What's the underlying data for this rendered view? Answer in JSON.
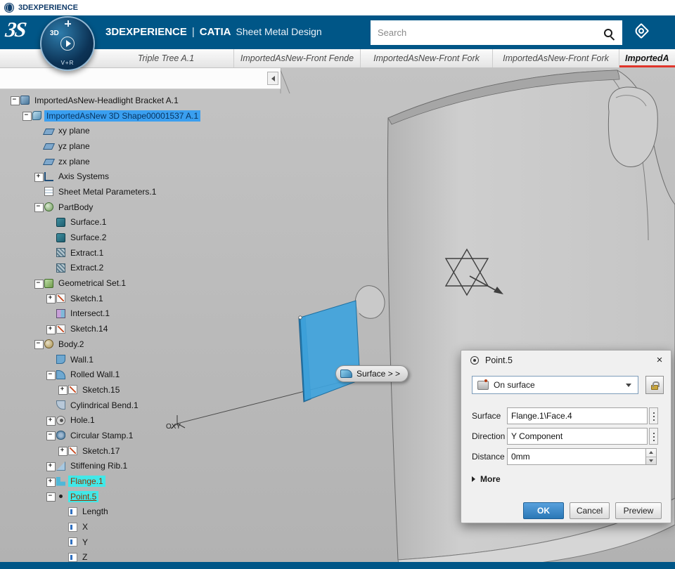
{
  "os_bar": {
    "brand": "3DEXPERIENCE"
  },
  "header": {
    "logo": "3S",
    "product": "3DEXPERIENCE",
    "divider": "|",
    "app": "CATIA",
    "workbench": "Sheet Metal Design",
    "search": {
      "placeholder": "Search"
    },
    "compass": {
      "top": "3D",
      "bottom": "V+R"
    }
  },
  "tabs": [
    {
      "label": "Triple Tree A.1",
      "active": false
    },
    {
      "label": "ImportedAsNew-Front Fende",
      "active": false
    },
    {
      "label": "ImportedAsNew-Front Fork",
      "active": false
    },
    {
      "label": "ImportedAsNew-Front Fork",
      "active": false
    },
    {
      "label": "ImportedA",
      "active": true
    }
  ],
  "tree": [
    {
      "label": "ImportedAsNew-Headlight Bracket A.1",
      "icon": "product",
      "state": "expanded"
    },
    {
      "label": "ImportedAsNew 3D Shape00001537 A.1",
      "icon": "3d-shape",
      "state": "expanded",
      "selected": true
    },
    {
      "label": "xy plane",
      "icon": "plane"
    },
    {
      "label": "yz plane",
      "icon": "plane"
    },
    {
      "label": "zx plane",
      "icon": "plane"
    },
    {
      "label": "Axis Systems",
      "icon": "axis-systems",
      "state": "collapsed"
    },
    {
      "label": "Sheet Metal Parameters.1",
      "icon": "sheet-metal-parameters"
    },
    {
      "label": "PartBody",
      "icon": "part-body",
      "state": "expanded"
    },
    {
      "label": "Surface.1",
      "icon": "surface"
    },
    {
      "label": "Surface.2",
      "icon": "surface"
    },
    {
      "label": "Extract.1",
      "icon": "extract"
    },
    {
      "label": "Extract.2",
      "icon": "extract"
    },
    {
      "label": "Geometrical Set.1",
      "icon": "geometrical-set",
      "state": "expanded"
    },
    {
      "label": "Sketch.1",
      "icon": "sketch",
      "state": "collapsed"
    },
    {
      "label": "Intersect.1",
      "icon": "intersect"
    },
    {
      "label": "Sketch.14",
      "icon": "sketch",
      "state": "collapsed"
    },
    {
      "label": "Body.2",
      "icon": "body",
      "state": "expanded"
    },
    {
      "label": "Wall.1",
      "icon": "wall"
    },
    {
      "label": "Rolled Wall.1",
      "icon": "rolled-wall",
      "state": "expanded"
    },
    {
      "label": "Sketch.15",
      "icon": "sketch",
      "state": "collapsed"
    },
    {
      "label": "Cylindrical Bend.1",
      "icon": "cylindrical-bend"
    },
    {
      "label": "Hole.1",
      "icon": "hole",
      "state": "collapsed"
    },
    {
      "label": "Circular Stamp.1",
      "icon": "circular-stamp",
      "state": "expanded"
    },
    {
      "label": "Sketch.17",
      "icon": "sketch",
      "state": "collapsed"
    },
    {
      "label": "Stiffening Rib.1",
      "icon": "stiffening-rib",
      "state": "collapsed"
    },
    {
      "label": "Flange.1",
      "icon": "flange",
      "state": "collapsed",
      "highlighted": true
    },
    {
      "label": "Point.5",
      "icon": "point",
      "state": "expanded",
      "highlighted": true,
      "in_edit": true
    },
    {
      "label": "Length",
      "icon": "parameter"
    },
    {
      "label": "X",
      "icon": "parameter"
    },
    {
      "label": "Y",
      "icon": "parameter"
    },
    {
      "label": "Z",
      "icon": "parameter"
    }
  ],
  "viewport": {
    "tooltip": "Surface > >",
    "origin_label": "OXY"
  },
  "dialog": {
    "title": "Point.5",
    "close_icon": "×",
    "point_type": "On surface",
    "fields": [
      {
        "label": "Surface",
        "value": "Flange.1\\Face.4"
      },
      {
        "label": "Direction",
        "value": "Y Component"
      },
      {
        "label": "Distance",
        "value": "0mm"
      }
    ],
    "more": "More",
    "buttons": {
      "ok": "OK",
      "cancel": "Cancel",
      "preview": "Preview"
    }
  },
  "colors": {
    "header_blue": "#005687",
    "active_tab_red": "#e0352b",
    "selection_blue": "#3a9ff0",
    "highlight_cyan": "#41e8e8",
    "flange_face_blue": "#3fa3dc",
    "ok_button_blue": "#2e7fc6"
  }
}
